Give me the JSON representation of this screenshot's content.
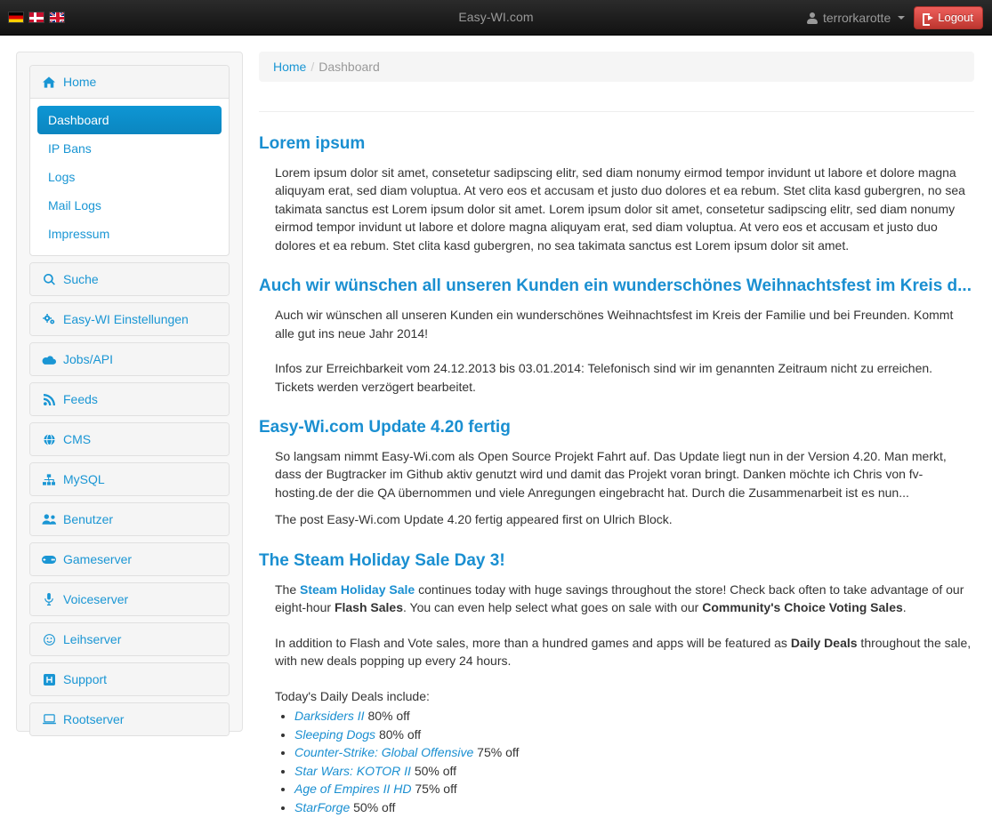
{
  "navbar": {
    "brand": "Easy-WI.com",
    "flags": [
      {
        "name": "german-flag",
        "title": "Deutsch"
      },
      {
        "name": "danish-flag",
        "title": "Dansk"
      },
      {
        "name": "english-flag",
        "title": "English"
      }
    ],
    "username": "terrorkarotte",
    "logout_label": "Logout"
  },
  "breadcrumb": {
    "home": "Home",
    "separator": "/",
    "current": "Dashboard"
  },
  "sidebar": {
    "home_panel": {
      "icon": "home-icon",
      "label": "Home",
      "items": [
        {
          "label": "Dashboard",
          "active": true
        },
        {
          "label": "IP Bans",
          "active": false
        },
        {
          "label": "Logs",
          "active": false
        },
        {
          "label": "Mail Logs",
          "active": false
        },
        {
          "label": "Impressum",
          "active": false
        }
      ]
    },
    "panels": [
      {
        "icon": "search-icon",
        "label": "Suche"
      },
      {
        "icon": "gears-icon",
        "label": "Easy-WI Einstellungen"
      },
      {
        "icon": "cloud-icon",
        "label": "Jobs/API"
      },
      {
        "icon": "rss-icon",
        "label": "Feeds"
      },
      {
        "icon": "globe-icon",
        "label": "CMS"
      },
      {
        "icon": "sitemap-icon",
        "label": "MySQL"
      },
      {
        "icon": "users-icon",
        "label": "Benutzer"
      },
      {
        "icon": "gamepad-icon",
        "label": "Gameserver"
      },
      {
        "icon": "microphone-icon",
        "label": "Voiceserver"
      },
      {
        "icon": "smile-icon",
        "label": "Leihserver"
      },
      {
        "icon": "hsquare-icon",
        "label": "Support"
      },
      {
        "icon": "laptop-icon",
        "label": "Rootserver"
      }
    ]
  },
  "posts": {
    "lorem": {
      "title": "Lorem ipsum",
      "paragraph": "Lorem ipsum dolor sit amet, consetetur sadipscing elitr, sed diam nonumy eirmod tempor invidunt ut labore et dolore magna aliquyam erat, sed diam voluptua. At vero eos et accusam et justo duo dolores et ea rebum. Stet clita kasd gubergren, no sea takimata sanctus est Lorem ipsum dolor sit amet. Lorem ipsum dolor sit amet, consetetur sadipscing elitr, sed diam nonumy eirmod tempor invidunt ut labore et dolore magna aliquyam erat, sed diam voluptua. At vero eos et accusam et justo duo dolores et ea rebum. Stet clita kasd gubergren, no sea takimata sanctus est Lorem ipsum dolor sit amet."
    },
    "weihnachten": {
      "title": "Auch wir wünschen all unseren Kunden ein wunderschönes Weihnachtsfest im Kreis d...",
      "paragraph1": "Auch wir wünschen all unseren Kunden ein wunderschönes Weihnachtsfest im Kreis der Familie und bei Freunden. Kommt alle gut ins neue Jahr 2014!",
      "paragraph2": "Infos zur Erreichbarkeit vom 24.12.2013 bis 03.01.2014: Telefonisch sind wir im genannten Zeitraum nicht zu erreichen. Tickets werden verzögert bearbeitet."
    },
    "update": {
      "title": "Easy-Wi.com Update 4.20 fertig",
      "paragraph1": "So langsam nimmt Easy-Wi.com als Open Source Projekt Fahrt auf. Das Update liegt nun in der Version 4.20. Man merkt, dass der Bugtracker im Github aktiv genutzt wird und damit das Projekt voran bringt. Danken möchte ich Chris von fv-hosting.de der die QA übernommen und viele Anregungen eingebracht hat. Durch die Zusammenarbeit ist es nun...",
      "paragraph2": "The post Easy-Wi.com Update 4.20 fertig appeared first on Ulrich Block."
    },
    "steam": {
      "title": "The Steam Holiday Sale Day 3!",
      "p1_before_link": "The ",
      "p1_link": "Steam Holiday Sale",
      "p1_mid1": " continues today with huge savings throughout the store! Check back often to take advantage of our eight-hour ",
      "p1_bold1": "Flash Sales",
      "p1_mid2": ". You can even help select what goes on sale with our ",
      "p1_bold2": "Community's Choice Voting Sales",
      "p1_end": ".",
      "p2_before": "In addition to Flash and Vote sales, more than a hundred games and apps will be featured as ",
      "p2_bold": "Daily Deals",
      "p2_after": " throughout the sale, with new deals popping up every 24 hours.",
      "deals_intro": "Today's Daily Deals include:",
      "deals": [
        {
          "game": "Darksiders II",
          "discount": "80% off"
        },
        {
          "game": "Sleeping Dogs",
          "discount": "80% off"
        },
        {
          "game": "Counter-Strike: Global Offensive",
          "discount": "75% off"
        },
        {
          "game": "Star Wars: KOTOR II",
          "discount": "50% off"
        },
        {
          "game": "Age of Empires II HD",
          "discount": "75% off"
        },
        {
          "game": "StarForge",
          "discount": "50% off"
        }
      ]
    }
  },
  "colors": {
    "link": "#1a8fd1",
    "active": "#0e96d4",
    "danger": "#bd362f",
    "navbar": "#121212"
  }
}
